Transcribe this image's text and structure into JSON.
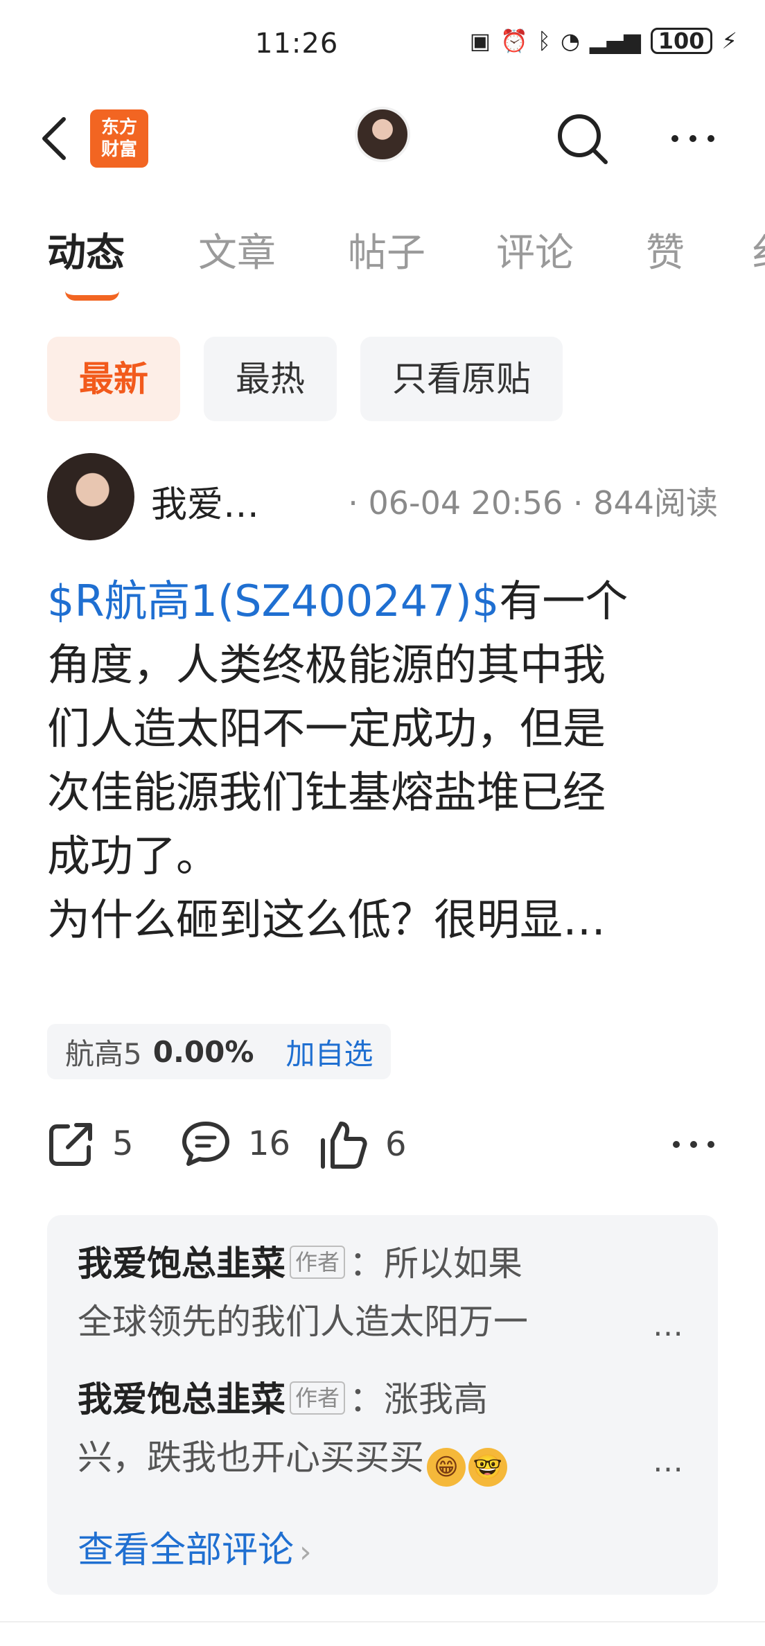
{
  "status_bar": {
    "time": "11:26",
    "battery": "100",
    "icons": [
      "nfc-icon",
      "alarm-icon",
      "bluetooth-icon",
      "wifi-icon",
      "5g-signal-icon",
      "battery-icon",
      "charging-icon"
    ]
  },
  "header": {
    "logo_line1": "东方",
    "logo_line2": "财富",
    "logo_color": "#f26522"
  },
  "tabs": [
    "动态",
    "文章",
    "帖子",
    "评论",
    "赞",
    "纟"
  ],
  "active_tab": "动态",
  "filters": [
    "最新",
    "最热",
    "只看原贴"
  ],
  "post": {
    "author": "我爱…",
    "date": "06-04 20:56",
    "reads": "844阅读",
    "stock_link": "$R航高1(SZ400247)$",
    "body_line1": "有一个",
    "body_line2": "角度，人类终极能源的其中我",
    "body_line3": "们人造太阳不一定成功，但是",
    "body_line4": "次佳能源我们钍基熔盐堆已经",
    "body_line5": "成功了。",
    "body_line6": "为什么砸到这么低？很明显…",
    "stock_tag": {
      "name": "航高5",
      "percent": "0.00%",
      "add_label": "加自选"
    },
    "actions": {
      "share_count": "5",
      "comment_count": "16",
      "like_count": "6"
    }
  },
  "comments": [
    {
      "name": "我爱饱总韭菜",
      "badge": "作者",
      "line1": "所以如果",
      "line2": "全球领先的我们人造太阳万一",
      "ellipsis": "…"
    },
    {
      "name": "我爱饱总韭菜",
      "badge": "作者",
      "line1": "涨我高",
      "line2": "兴，跌我也开心买买买",
      "ellipsis": "…"
    }
  ],
  "view_all_label": "查看全部评论",
  "colors": {
    "accent": "#f26522",
    "link": "#1f6fd1",
    "chip_bg": "#f4f5f7"
  }
}
